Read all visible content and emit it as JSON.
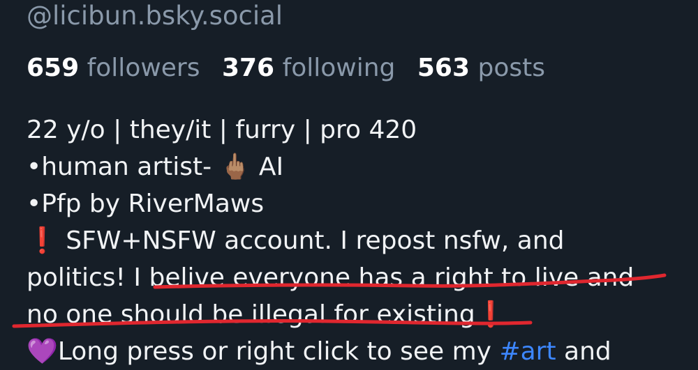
{
  "profile": {
    "handle": "@licibun.bsky.social",
    "stats": {
      "followers_count": "659",
      "followers_label": "followers",
      "following_count": "376",
      "following_label": "following",
      "posts_count": "563",
      "posts_label": "posts"
    },
    "bio": {
      "line1": "22 y/o | they/it | furry | pro 420",
      "line2_prefix": "•human artist- ",
      "line2_emoji": "🖕🏽",
      "line2_suffix": " AI",
      "line3": "•Pfp by RiverMaws",
      "line4_mark": "❗",
      "line4_text": "SFW+NSFW account. I repost nsfw, and",
      "line5": "politics! I belive everyone has a right to live and",
      "line6_text": "no one should be illegal for existing",
      "line6_mark": "❗",
      "line7_emoji": "💜",
      "line7_text": "Long press or right click to see my ",
      "line7_hashtag": "#art",
      "line7_suffix": " and"
    }
  },
  "annotation": {
    "color": "#e0272f"
  },
  "colors": {
    "background": "#161e27",
    "muted_text": "#8a99aa",
    "hashtag": "#3d87ff"
  }
}
